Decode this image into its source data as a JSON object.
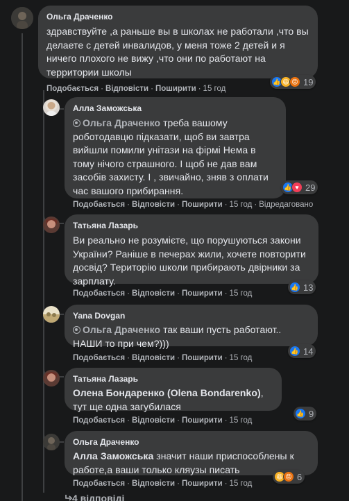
{
  "actions": {
    "like": "Подобається",
    "reply": "Відповісти",
    "share": "Поширити",
    "separator": "·"
  },
  "comments": [
    {
      "author": "Ольга Драченко",
      "mention": "",
      "text": "здравствуйте ,а раньше вы в школах не работали ,что вы делаете с детей инвалидов, у меня тоже 2 детей и я ничего плохого не вижу ,что они по работают на территории школы",
      "time": "15 год",
      "edited": "",
      "reactions": [
        "like",
        "haha",
        "angry"
      ],
      "reaction_count": "19"
    },
    {
      "author": "Алла Заможська",
      "mention": "Ольга Драченко",
      "text": "треба вашому роботодавцю підказати, щоб ви завтра вийшли помили унітази на фірмі Нема в тому нічого страшного. І щоб не дав вам засобів захисту. І , звичайно, зняв з оплати час вашого прибирання.",
      "time": "15 год",
      "edited": "Відредаговано",
      "reactions": [
        "like",
        "love"
      ],
      "reaction_count": "29"
    },
    {
      "author": "Татьяна Лазарь",
      "mention": "",
      "text": "Ви реально не розумієте, що порушуються закони України? Раніше в печерах жили, хочете повторити досвід? Територію школи прибирають двірники за зарплату.",
      "time": "15 год",
      "edited": "",
      "reactions": [
        "like"
      ],
      "reaction_count": "13"
    },
    {
      "author": "Yana Dovgan",
      "mention": "Ольга Драченко",
      "text": "так ваши пусть работают.. НАШИ то при чем?)))",
      "time": "15 год",
      "edited": "",
      "reactions": [
        "like"
      ],
      "reaction_count": "14"
    },
    {
      "author": "Татьяна Лазарь",
      "mention": "Олена Бондаренко (Olena Bondarenko)",
      "text": ", тут ще одна загубилася",
      "time": "15 год",
      "edited": "",
      "reactions": [
        "like"
      ],
      "reaction_count": "9"
    },
    {
      "author": "Ольга Драченко",
      "mention": "Алла Заможська",
      "text": "значит наши приспособлены к работе,а ваши только кляузы писать",
      "time": "15 год",
      "edited": "",
      "reactions": [
        "haha",
        "angry"
      ],
      "reaction_count": "6"
    }
  ],
  "more_replies": "4 відповіді",
  "colors": {
    "background": "#18191a",
    "bubble": "#3a3b3c",
    "text": "#e4e6eb",
    "secondary_text": "#b0b3b8",
    "like": "#1877f2",
    "love": "#f33e58",
    "haha": "#f7b125",
    "angry": "#e9710f"
  }
}
